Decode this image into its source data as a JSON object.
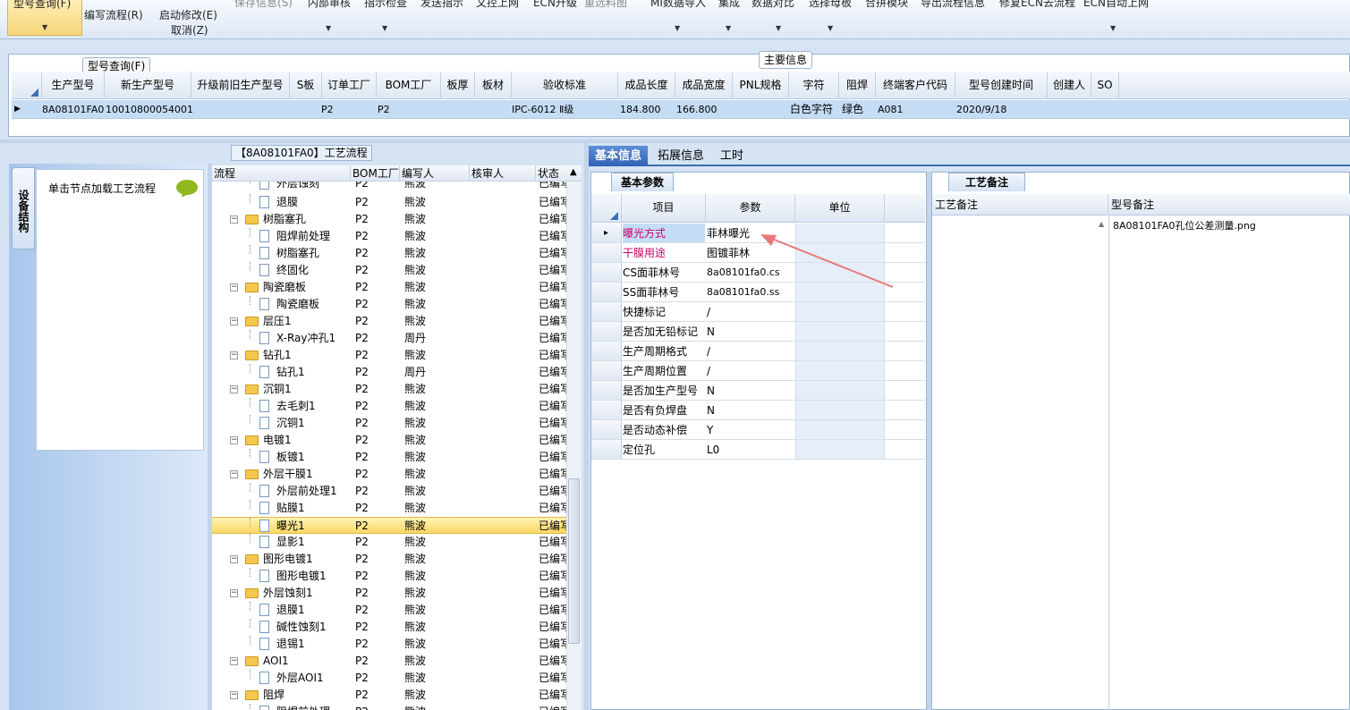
{
  "ribbon": {
    "model_query": "型号查询(F)",
    "write_flow": "编写流程(R)",
    "start_modify": "启动修改(E)",
    "cancel": "取消(Z)",
    "save_info": "保存信息(S)",
    "internal_review": "内部审核",
    "indicator_check": "指示检查",
    "send_indicator": "发送指示",
    "submit_online": "文控上网",
    "ecn_upgrade": "ECN升级",
    "reselect_material": "重选料图",
    "mi_import": "MI数据导入",
    "set_edit": "集成",
    "data_compare": "数据对比",
    "select_master": "选择母板",
    "merge_module": "合拼模块",
    "export_flow": "导出流程信息",
    "fix_ecn": "修复ECN去流程",
    "ecn_auto": "ECN自动上网"
  },
  "main_info": {
    "title": "主要信息",
    "tooltip": "型号查询(F)",
    "columns": [
      "生产型号",
      "新生产型号",
      "升级前旧生产型号",
      "S板",
      "订单工厂",
      "BOM工厂",
      "板厚",
      "板材",
      "验收标准",
      "成品长度",
      "成品宽度",
      "PNL规格",
      "字符",
      "阻焊",
      "终端客户代码",
      "型号创建时间",
      "创建人",
      "SO"
    ],
    "row": {
      "prod_model": "8A08101FA0",
      "new_model": "10010800054001",
      "order_factory": "P2",
      "bom_factory": "P2",
      "standard": "IPC-6012 Ⅱ级",
      "length": "184.800",
      "width": "166.800",
      "char": "白色字符",
      "mask": "绿色",
      "customer": "A081",
      "created": "2020/9/18"
    }
  },
  "left": {
    "vert_tab": "设备结构",
    "hint": "单击节点加载工艺流程"
  },
  "flow": {
    "title": "【8A08101FA0】工艺流程",
    "columns": [
      "流程",
      "BOM工厂",
      "编写人",
      "核审人",
      "状态"
    ],
    "rows": [
      {
        "name": "外层蚀刻",
        "bom": "P2",
        "writer": "熊波",
        "status": "已编写"
      },
      {
        "name": "退膜",
        "bom": "P2",
        "writer": "熊波",
        "status": "已编写"
      },
      {
        "name": "树脂塞孔",
        "bom": "P2",
        "writer": "熊波",
        "status": "已编写"
      },
      {
        "name": "阻焊前处理",
        "bom": "P2",
        "writer": "熊波",
        "status": "已编写"
      },
      {
        "name": "树脂塞孔",
        "bom": "P2",
        "writer": "熊波",
        "status": "已编写"
      },
      {
        "name": "终固化",
        "bom": "P2",
        "writer": "熊波",
        "status": "已编写"
      },
      {
        "name": "陶瓷磨板",
        "bom": "P2",
        "writer": "熊波",
        "status": "已编写"
      },
      {
        "name": "陶瓷磨板",
        "bom": "P2",
        "writer": "熊波",
        "status": "已编写"
      },
      {
        "name": "层压1",
        "bom": "P2",
        "writer": "熊波",
        "status": "已编写"
      },
      {
        "name": "X-Ray冲孔1",
        "bom": "P2",
        "writer": "周丹",
        "status": "已编写"
      },
      {
        "name": "钻孔1",
        "bom": "P2",
        "writer": "熊波",
        "status": "已编写"
      },
      {
        "name": "钻孔1",
        "bom": "P2",
        "writer": "周丹",
        "status": "已编写"
      },
      {
        "name": "沉铜1",
        "bom": "P2",
        "writer": "熊波",
        "status": "已编写"
      },
      {
        "name": "去毛刺1",
        "bom": "P2",
        "writer": "熊波",
        "status": "已编写"
      },
      {
        "name": "沉铜1",
        "bom": "P2",
        "writer": "熊波",
        "status": "已编写"
      },
      {
        "name": "电镀1",
        "bom": "P2",
        "writer": "熊波",
        "status": "已编写"
      },
      {
        "name": "板镀1",
        "bom": "P2",
        "writer": "熊波",
        "status": "已编写"
      },
      {
        "name": "外层干膜1",
        "bom": "P2",
        "writer": "熊波",
        "status": "已编写"
      },
      {
        "name": "外层前处理1",
        "bom": "P2",
        "writer": "熊波",
        "status": "已编写"
      },
      {
        "name": "贴膜1",
        "bom": "P2",
        "writer": "熊波",
        "status": "已编写"
      },
      {
        "name": "曝光1",
        "bom": "P2",
        "writer": "熊波",
        "status": "已编写"
      },
      {
        "name": "显影1",
        "bom": "P2",
        "writer": "熊波",
        "status": "已编写"
      },
      {
        "name": "图形电镀1",
        "bom": "P2",
        "writer": "熊波",
        "status": "已编写"
      },
      {
        "name": "图形电镀1",
        "bom": "P2",
        "writer": "熊波",
        "status": "已编写"
      },
      {
        "name": "外层蚀刻1",
        "bom": "P2",
        "writer": "熊波",
        "status": "已编写"
      },
      {
        "name": "退膜1",
        "bom": "P2",
        "writer": "熊波",
        "status": "已编写"
      },
      {
        "name": "碱性蚀刻1",
        "bom": "P2",
        "writer": "熊波",
        "status": "已编写"
      },
      {
        "name": "退锡1",
        "bom": "P2",
        "writer": "熊波",
        "status": "已编写"
      },
      {
        "name": "AOI1",
        "bom": "P2",
        "writer": "熊波",
        "status": "已编写"
      },
      {
        "name": "外层AOI1",
        "bom": "P2",
        "writer": "熊波",
        "status": "已编写"
      },
      {
        "name": "阻焊",
        "bom": "P2",
        "writer": "熊波",
        "status": "已编写"
      },
      {
        "name": "阻焊前处理",
        "bom": "P2",
        "writer": "熊波",
        "status": "已编写"
      }
    ]
  },
  "tabs": [
    "基本信息",
    "拓展信息",
    "工时"
  ],
  "basic": {
    "title": "基本参数",
    "col_item": "项目",
    "col_param": "参数",
    "col_unit": "单位",
    "rows": [
      {
        "item": "曝光方式",
        "param": "菲林曝光",
        "accent": true
      },
      {
        "item": "干膜用途",
        "param": "图镀菲林",
        "accent": true
      },
      {
        "item": "CS面菲林号",
        "param": "8a08101fa0.cs",
        "accent": false
      },
      {
        "item": "SS面菲林号",
        "param": "8a08101fa0.ss",
        "accent": false
      },
      {
        "item": "快捷标记",
        "param": "/",
        "accent": false
      },
      {
        "item": "是否加无铅标记",
        "param": "N",
        "accent": false
      },
      {
        "item": "生产周期格式",
        "param": "/",
        "accent": false
      },
      {
        "item": "生产周期位置",
        "param": "/",
        "accent": false
      },
      {
        "item": "是否加生产型号",
        "param": "N",
        "accent": false
      },
      {
        "item": "是否有负焊盘",
        "param": "N",
        "accent": false
      },
      {
        "item": "是否动态补偿",
        "param": "Y",
        "accent": false
      },
      {
        "item": "定位孔",
        "param": "L0",
        "accent": false
      }
    ]
  },
  "remark": {
    "title": "工艺备注",
    "col_process": "工艺备注",
    "col_model": "型号备注",
    "model_note": "8A08101FA0孔位公差测量.png"
  },
  "colors": {
    "accent_text": "#cc0066",
    "arrow": "#e87878",
    "selection": "#c5dcf5"
  }
}
